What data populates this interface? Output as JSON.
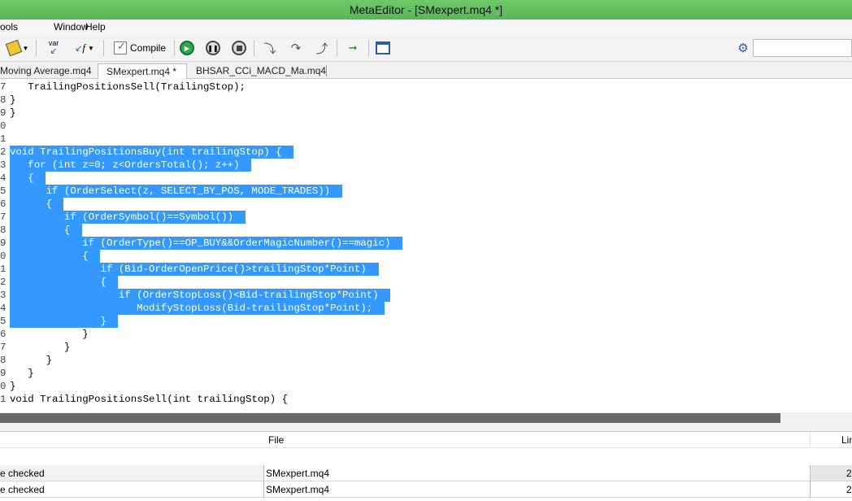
{
  "window": {
    "title": "MetaEditor - [SMexpert.mq4 *]"
  },
  "menu": {
    "items": [
      "ools",
      "Window",
      "Help"
    ]
  },
  "toolbar": {
    "var_label": "var",
    "f_label": "f",
    "compile_label": "Compile",
    "search_placeholder": "",
    "icons": [
      "navigator-icon",
      "insert-var-icon",
      "insert-function-icon",
      "compile-icon",
      "start-icon",
      "pause-icon",
      "stop-icon",
      "step-into-icon",
      "step-over-icon",
      "step-out-icon",
      "run-icon",
      "chart-icon",
      "gear-icon"
    ]
  },
  "tabs": [
    {
      "label": "Moving Average.mq4",
      "active": false
    },
    {
      "label": "SMexpert.mq4 *",
      "active": true
    },
    {
      "label": "BHSAR_CCi_MACD_Ma.mq4",
      "active": false
    }
  ],
  "editor": {
    "lines": [
      {
        "num": "7",
        "text": "   TrailingPositionsSell(TrailingStop);",
        "selected": false
      },
      {
        "num": "8",
        "text": "}",
        "selected": false
      },
      {
        "num": "9",
        "text": "}",
        "selected": false
      },
      {
        "num": "0",
        "text": "",
        "selected": false
      },
      {
        "num": "1",
        "text": "",
        "selected": false
      },
      {
        "num": "2",
        "text": "void TrailingPositionsBuy(int trailingStop) {",
        "selected": true
      },
      {
        "num": "3",
        "text": "   for (int z=0; z<OrdersTotal(); z++)",
        "selected": true
      },
      {
        "num": "4",
        "text": "   {",
        "selected": true
      },
      {
        "num": "5",
        "text": "      if (OrderSelect(z, SELECT_BY_POS, MODE_TRADES))",
        "selected": true
      },
      {
        "num": "6",
        "text": "      {",
        "selected": true
      },
      {
        "num": "7",
        "text": "         if (OrderSymbol()==Symbol())",
        "selected": true
      },
      {
        "num": "8",
        "text": "         {",
        "selected": true
      },
      {
        "num": "9",
        "text": "            if (OrderType()==OP_BUY&&OrderMagicNumber()==magic)",
        "selected": true
      },
      {
        "num": "0",
        "text": "            {",
        "selected": true
      },
      {
        "num": "1",
        "text": "               if (Bid-OrderOpenPrice()>trailingStop*Point)",
        "selected": true
      },
      {
        "num": "2",
        "text": "               {",
        "selected": true
      },
      {
        "num": "3",
        "text": "                  if (OrderStopLoss()<Bid-trailingStop*Point)",
        "selected": true
      },
      {
        "num": "4",
        "text": "                     ModifyStopLoss(Bid-trailingStop*Point);",
        "selected": true
      },
      {
        "num": "5",
        "text": "               }",
        "selected": true
      },
      {
        "num": "6",
        "text": "            }",
        "selected": false
      },
      {
        "num": "7",
        "text": "         }",
        "selected": false
      },
      {
        "num": "8",
        "text": "      }",
        "selected": false
      },
      {
        "num": "9",
        "text": "   }",
        "selected": false
      },
      {
        "num": "0",
        "text": "}",
        "selected": false
      },
      {
        "num": "1",
        "text": "void TrailingPositionsSell(int trailingStop) {",
        "selected": false
      }
    ]
  },
  "errors_panel": {
    "columns": [
      "File",
      "Lin"
    ],
    "rows": [
      {
        "description": "e checked",
        "file": "SMexpert.mq4",
        "line": "2"
      },
      {
        "description": "e checked",
        "file": "SMexpert.mq4",
        "line": "2"
      }
    ]
  },
  "colors": {
    "selection": "#3399ff",
    "titlebar": "#5ab557"
  }
}
